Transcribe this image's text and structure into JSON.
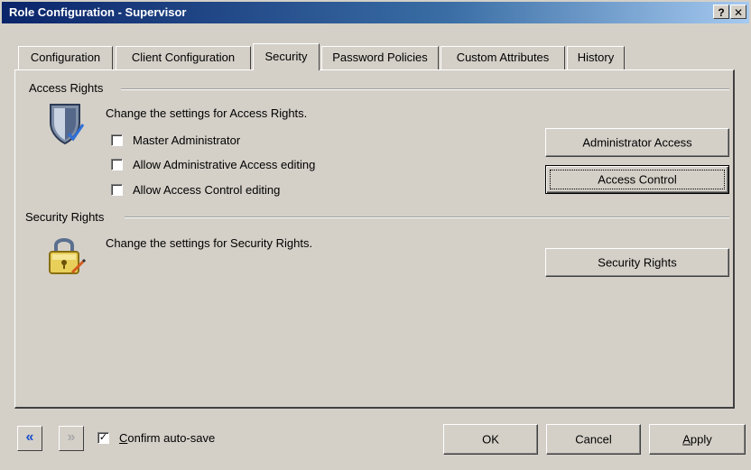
{
  "window": {
    "title": "Role Configuration - Supervisor",
    "help_glyph": "?",
    "close_glyph": "✕"
  },
  "tabs": [
    {
      "label": "Configuration",
      "active": false
    },
    {
      "label": "Client Configuration",
      "active": false
    },
    {
      "label": "Security",
      "active": true
    },
    {
      "label": "Password Policies",
      "active": false
    },
    {
      "label": "Custom Attributes",
      "active": false
    },
    {
      "label": "History",
      "active": false
    }
  ],
  "access_rights": {
    "group_label": "Access Rights",
    "icon": "shield-icon",
    "description": "Change the settings for Access Rights.",
    "checkboxes": [
      {
        "label": "Master Administrator",
        "checked": false
      },
      {
        "label": "Allow Administrative Access editing",
        "checked": false
      },
      {
        "label": "Allow Access Control editing",
        "checked": false
      }
    ],
    "buttons": {
      "administrator_access": "Administrator Access",
      "access_control": "Access Control"
    }
  },
  "security_rights": {
    "group_label": "Security Rights",
    "icon": "padlock-icon",
    "description": "Change the settings for Security Rights.",
    "button": "Security Rights"
  },
  "footer": {
    "back_glyph": "«",
    "forward_glyph": "»",
    "confirm_autosave_first": "C",
    "confirm_autosave_rest": "onfirm auto-save",
    "confirm_autosave_checked": true,
    "check_glyph": "✓",
    "ok": "OK",
    "cancel": "Cancel",
    "apply_first": "A",
    "apply_rest": "pply"
  },
  "colors": {
    "titlebar_start": "#0a246a",
    "titlebar_end": "#a6caf0",
    "face": "#d4d0c8"
  }
}
